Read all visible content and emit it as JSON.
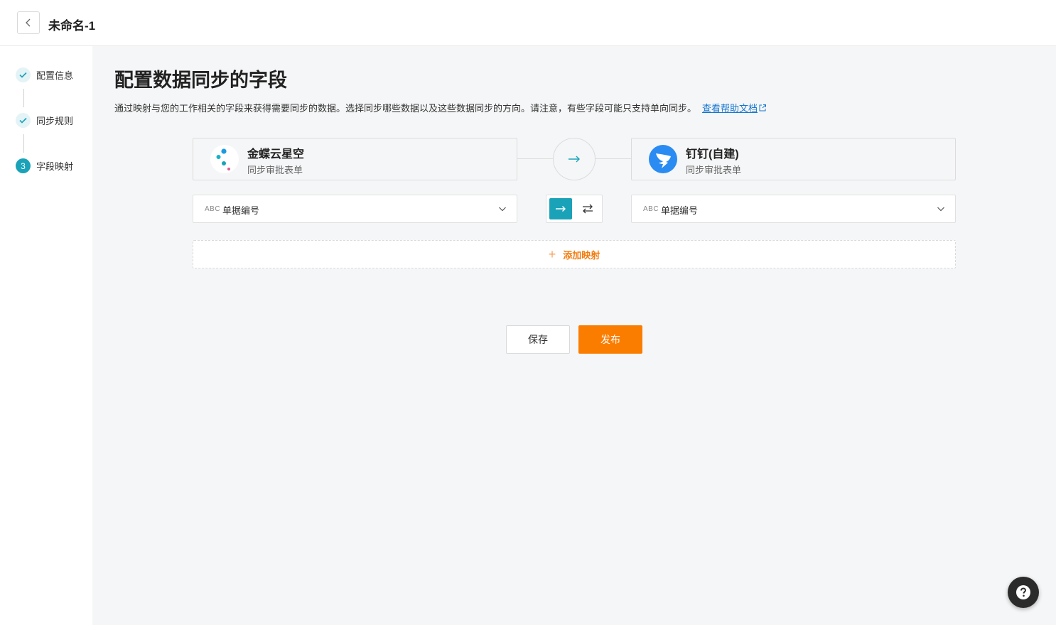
{
  "header": {
    "title": "未命名-1"
  },
  "steps": [
    {
      "label": "配置信息",
      "status": "done"
    },
    {
      "label": "同步规则",
      "status": "done"
    },
    {
      "label": "字段映射",
      "status": "active",
      "number": "3"
    }
  ],
  "main": {
    "title": "配置数据同步的字段",
    "description": "通过映射与您的工作相关的字段来获得需要同步的数据。选择同步哪些数据以及这些数据同步的方向。请注意，有些字段可能只支持单向同步。",
    "help_link": "查看帮助文档"
  },
  "source_app": {
    "name": "金蝶云星空",
    "subtitle": "同步审批表单",
    "icon": "kingdee-logo-icon"
  },
  "target_app": {
    "name": "钉钉(自建)",
    "subtitle": "同步审批表单",
    "icon": "dingtalk-logo-icon"
  },
  "mapping": {
    "source_field_type": "ABC",
    "source_field": "单据编号",
    "target_field_type": "ABC",
    "target_field": "单据编号",
    "direction": "one-way"
  },
  "add_mapping_label": "添加映射",
  "buttons": {
    "save": "保存",
    "publish": "发布"
  },
  "colors": {
    "accent": "#1aa3b8",
    "primary": "#fb7d00",
    "link": "#1677d2"
  }
}
